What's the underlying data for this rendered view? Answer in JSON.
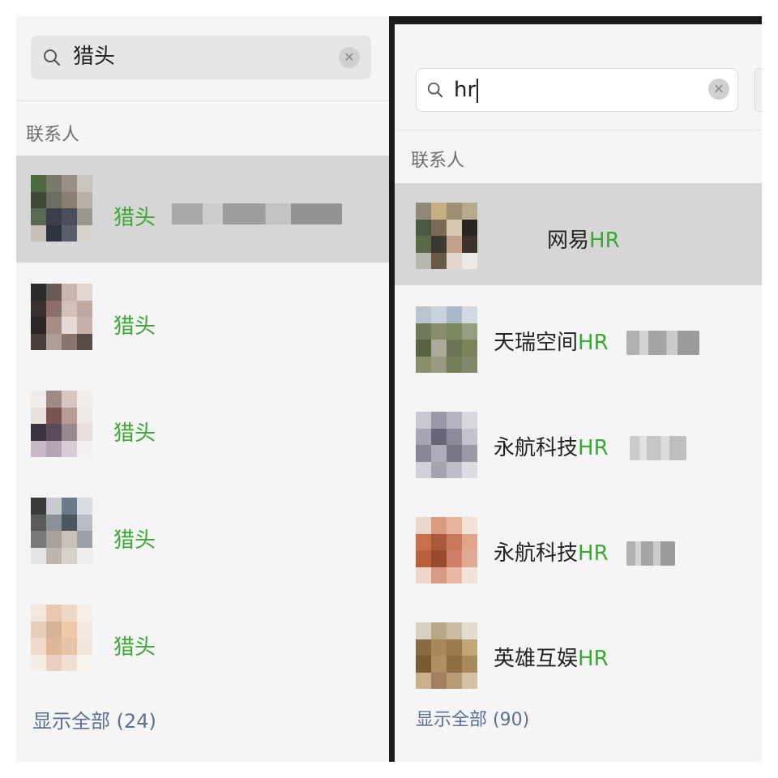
{
  "left": {
    "search_query": "猎头",
    "section_label": "联系人",
    "contacts": [
      {
        "highlight": "猎头",
        "suffix": ""
      },
      {
        "highlight": "猎头",
        "suffix": ""
      },
      {
        "highlight": "猎头",
        "suffix": ""
      },
      {
        "highlight": "猎头",
        "suffix": ""
      },
      {
        "highlight": "猎头",
        "suffix": ""
      }
    ],
    "show_all": "显示全部 (24)"
  },
  "right": {
    "search_query": "hr",
    "section_label": "联系人",
    "contacts": [
      {
        "prefix": "网易",
        "highlight": "HR"
      },
      {
        "prefix": "天瑞空间",
        "highlight": "HR"
      },
      {
        "prefix": "永航科技",
        "highlight": "HR"
      },
      {
        "prefix": "永航科技",
        "highlight": "HR"
      },
      {
        "prefix": "英雄互娱",
        "highlight": "HR"
      }
    ],
    "show_all": "显示全部 (90)"
  },
  "colors": {
    "highlight": "#3aa835",
    "link": "#5c6f94",
    "selected_row": "#d6d6d6",
    "panel_bg": "#f5f5f5"
  },
  "icons": {
    "search": "search-icon",
    "clear": "clear-icon"
  }
}
